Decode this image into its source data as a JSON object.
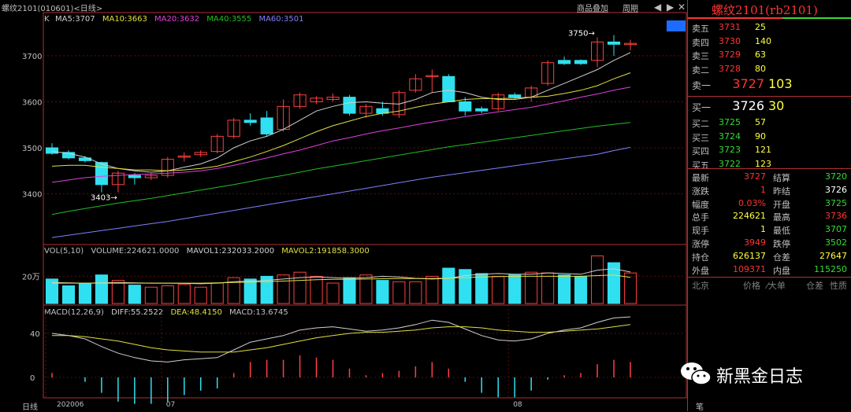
{
  "window": {
    "title": "螺纹2101(010601)<日线>",
    "product_overlay": "商品叠加",
    "period": "周期"
  },
  "ma_legend": {
    "k": "K",
    "ma5": "MA5:3707",
    "ma10": "MA10:3663",
    "ma20": "MA20:3632",
    "ma40": "MA40:3555",
    "ma60": "MA60:3501",
    "colors": {
      "ma5": "#d0d0d0",
      "ma10": "#e0e040",
      "ma20": "#e040e0",
      "ma40": "#20c020",
      "ma60": "#8080ff"
    }
  },
  "vol_legend": {
    "vol": "VOL(5,10)",
    "volume": "VOLUME:224621.0000",
    "mavol1": "MAVOL1:232033.2000",
    "mavol2": "MAVOL2:191858.3000"
  },
  "macd_legend": {
    "macd": "MACD(12,26,9)",
    "diff": "DIFF:55.2522",
    "dea": "DEA:48.4150",
    "macd_val": "MACD:13.6745"
  },
  "price_axis": [
    "3700",
    "3600",
    "3500",
    "3400"
  ],
  "vol_axis": [
    "20万"
  ],
  "macd_axis": [
    "40",
    "0"
  ],
  "date_axis": [
    "202006",
    "07",
    "08"
  ],
  "annotations": {
    "high": "3750",
    "low": "3403"
  },
  "bottom_tab": "日线",
  "chart_data": {
    "type": "candlestick",
    "candles": [
      {
        "o": 3500,
        "h": 3510,
        "l": 3485,
        "c": 3488
      },
      {
        "o": 3490,
        "h": 3495,
        "l": 3475,
        "c": 3478
      },
      {
        "o": 3478,
        "h": 3482,
        "l": 3468,
        "c": 3472
      },
      {
        "o": 3468,
        "h": 3470,
        "l": 3403,
        "c": 3420
      },
      {
        "o": 3420,
        "h": 3450,
        "l": 3403,
        "c": 3445
      },
      {
        "o": 3440,
        "h": 3445,
        "l": 3420,
        "c": 3435
      },
      {
        "o": 3435,
        "h": 3445,
        "l": 3430,
        "c": 3440
      },
      {
        "o": 3440,
        "h": 3480,
        "l": 3435,
        "c": 3475
      },
      {
        "o": 3480,
        "h": 3490,
        "l": 3470,
        "c": 3482
      },
      {
        "o": 3485,
        "h": 3495,
        "l": 3480,
        "c": 3490
      },
      {
        "o": 3492,
        "h": 3530,
        "l": 3488,
        "c": 3525
      },
      {
        "o": 3525,
        "h": 3565,
        "l": 3520,
        "c": 3560
      },
      {
        "o": 3560,
        "h": 3575,
        "l": 3548,
        "c": 3555
      },
      {
        "o": 3565,
        "h": 3580,
        "l": 3525,
        "c": 3530
      },
      {
        "o": 3540,
        "h": 3605,
        "l": 3535,
        "c": 3590
      },
      {
        "o": 3590,
        "h": 3620,
        "l": 3585,
        "c": 3615
      },
      {
        "o": 3600,
        "h": 3612,
        "l": 3595,
        "c": 3608
      },
      {
        "o": 3605,
        "h": 3618,
        "l": 3600,
        "c": 3610
      },
      {
        "o": 3610,
        "h": 3615,
        "l": 3570,
        "c": 3575
      },
      {
        "o": 3575,
        "h": 3595,
        "l": 3565,
        "c": 3590
      },
      {
        "o": 3585,
        "h": 3600,
        "l": 3570,
        "c": 3575
      },
      {
        "o": 3572,
        "h": 3625,
        "l": 3565,
        "c": 3620
      },
      {
        "o": 3625,
        "h": 3660,
        "l": 3620,
        "c": 3650
      },
      {
        "o": 3655,
        "h": 3670,
        "l": 3620,
        "c": 3657
      },
      {
        "o": 3655,
        "h": 3660,
        "l": 3600,
        "c": 3600
      },
      {
        "o": 3600,
        "h": 3610,
        "l": 3570,
        "c": 3580
      },
      {
        "o": 3585,
        "h": 3590,
        "l": 3575,
        "c": 3580
      },
      {
        "o": 3585,
        "h": 3620,
        "l": 3580,
        "c": 3615
      },
      {
        "o": 3615,
        "h": 3620,
        "l": 3605,
        "c": 3610
      },
      {
        "o": 3610,
        "h": 3635,
        "l": 3600,
        "c": 3630
      },
      {
        "o": 3640,
        "h": 3690,
        "l": 3635,
        "c": 3685
      },
      {
        "o": 3690,
        "h": 3698,
        "l": 3680,
        "c": 3683
      },
      {
        "o": 3690,
        "h": 3692,
        "l": 3680,
        "c": 3683
      },
      {
        "o": 3690,
        "h": 3740,
        "l": 3675,
        "c": 3730
      },
      {
        "o": 3730,
        "h": 3745,
        "l": 3700,
        "c": 3725
      },
      {
        "o": 3725,
        "h": 3735,
        "l": 3712,
        "c": 3727
      }
    ],
    "ma5": [
      3492,
      3488,
      3480,
      3465,
      3455,
      3450,
      3447,
      3450,
      3458,
      3465,
      3478,
      3500,
      3515,
      3525,
      3540,
      3560,
      3580,
      3590,
      3598,
      3600,
      3597,
      3595,
      3605,
      3620,
      3625,
      3620,
      3610,
      3605,
      3605,
      3610,
      3625,
      3640,
      3655,
      3670,
      3690,
      3707
    ],
    "ma10": [
      3460,
      3462,
      3462,
      3458,
      3455,
      3452,
      3452,
      3450,
      3452,
      3455,
      3460,
      3470,
      3480,
      3492,
      3505,
      3520,
      3535,
      3548,
      3558,
      3568,
      3575,
      3580,
      3588,
      3595,
      3600,
      3605,
      3607,
      3607,
      3608,
      3610,
      3612,
      3618,
      3625,
      3635,
      3650,
      3663
    ],
    "ma20": [
      3425,
      3430,
      3435,
      3438,
      3440,
      3442,
      3443,
      3445,
      3447,
      3450,
      3455,
      3462,
      3470,
      3478,
      3487,
      3495,
      3505,
      3515,
      3522,
      3530,
      3537,
      3543,
      3550,
      3556,
      3562,
      3568,
      3573,
      3578,
      3583,
      3588,
      3595,
      3602,
      3610,
      3617,
      3625,
      3632
    ],
    "ma40": [
      3355,
      3362,
      3368,
      3374,
      3380,
      3385,
      3390,
      3396,
      3402,
      3408,
      3414,
      3420,
      3427,
      3434,
      3440,
      3447,
      3454,
      3460,
      3466,
      3472,
      3478,
      3484,
      3490,
      3496,
      3502,
      3507,
      3512,
      3517,
      3522,
      3527,
      3532,
      3537,
      3542,
      3547,
      3551,
      3555
    ],
    "ma60": [
      3305,
      3310,
      3315,
      3320,
      3325,
      3330,
      3335,
      3340,
      3346,
      3352,
      3358,
      3364,
      3370,
      3376,
      3382,
      3388,
      3394,
      3400,
      3406,
      3412,
      3418,
      3424,
      3430,
      3436,
      3441,
      3446,
      3451,
      3456,
      3461,
      3466,
      3471,
      3476,
      3481,
      3486,
      3494,
      3501
    ],
    "volume": [
      180000,
      130000,
      145000,
      210000,
      170000,
      135000,
      120000,
      130000,
      140000,
      120000,
      150000,
      190000,
      180000,
      200000,
      210000,
      230000,
      200000,
      150000,
      190000,
      210000,
      170000,
      160000,
      160000,
      200000,
      260000,
      250000,
      220000,
      200000,
      210000,
      230000,
      225000,
      210000,
      200000,
      350000,
      300000,
      224621
    ],
    "mavol1": [
      155000,
      152000,
      150000,
      152000,
      155000,
      152000,
      150000,
      150000,
      148000,
      145000,
      150000,
      160000,
      165000,
      170000,
      180000,
      190000,
      195000,
      190000,
      185000,
      190000,
      200000,
      195000,
      185000,
      180000,
      185000,
      205000,
      215000,
      220000,
      215000,
      215000,
      225000,
      220000,
      215000,
      245000,
      255000,
      232033
    ],
    "mavol2": [
      150000,
      150000,
      150000,
      150000,
      150000,
      150000,
      150000,
      150000,
      150000,
      150000,
      152000,
      155000,
      158000,
      160000,
      165000,
      170000,
      175000,
      178000,
      178000,
      180000,
      182000,
      183000,
      183000,
      184000,
      186000,
      190000,
      195000,
      198000,
      200000,
      200000,
      200000,
      200000,
      200000,
      205000,
      210000,
      191858
    ],
    "diff": [
      40,
      38,
      35,
      28,
      22,
      18,
      15,
      14,
      16,
      17,
      18,
      25,
      32,
      35,
      38,
      43,
      45,
      46,
      44,
      42,
      43,
      45,
      48,
      52,
      50,
      44,
      38,
      34,
      33,
      35,
      40,
      43,
      45,
      50,
      54,
      55
    ],
    "dea": [
      38,
      38,
      37,
      35,
      33,
      30,
      27,
      25,
      24,
      23,
      23,
      23,
      25,
      27,
      30,
      33,
      36,
      38,
      40,
      41,
      41,
      42,
      43,
      45,
      46,
      46,
      45,
      43,
      42,
      41,
      41,
      42,
      43,
      44,
      46,
      48
    ],
    "ylim": [
      3300,
      3770
    ]
  },
  "quote": {
    "title": "螺纹2101(rb2101)",
    "asks": [
      {
        "label": "卖五",
        "price": "3731",
        "vol": "25"
      },
      {
        "label": "卖四",
        "price": "3730",
        "vol": "140"
      },
      {
        "label": "卖三",
        "price": "3729",
        "vol": "63"
      },
      {
        "label": "卖二",
        "price": "3728",
        "vol": "80"
      },
      {
        "label": "卖一",
        "price": "3727",
        "vol": "103"
      }
    ],
    "bids": [
      {
        "label": "买一",
        "price": "3726",
        "vol": "30"
      },
      {
        "label": "买二",
        "price": "3725",
        "vol": "57"
      },
      {
        "label": "买三",
        "price": "3724",
        "vol": "90"
      },
      {
        "label": "买四",
        "price": "3723",
        "vol": "121"
      },
      {
        "label": "买五",
        "price": "3722",
        "vol": "123"
      }
    ],
    "stats": [
      {
        "l1": "最新",
        "v1": "3727",
        "c1": "red",
        "l2": "结算",
        "v2": "3720",
        "c2": "green"
      },
      {
        "l1": "涨跌",
        "v1": "1",
        "c1": "red",
        "l2": "昨结",
        "v2": "3726",
        "c2": "white"
      },
      {
        "l1": "幅度",
        "v1": "0.03%",
        "c1": "red",
        "l2": "开盘",
        "v2": "3725",
        "c2": "green"
      },
      {
        "l1": "总手",
        "v1": "224621",
        "c1": "yellow",
        "l2": "最高",
        "v2": "3736",
        "c2": "red"
      },
      {
        "l1": "现手",
        "v1": "1",
        "c1": "yellow",
        "l2": "最低",
        "v2": "3707",
        "c2": "green"
      },
      {
        "l1": "涨停",
        "v1": "3949",
        "c1": "red",
        "l2": "跌停",
        "v2": "3502",
        "c2": "green"
      },
      {
        "l1": "持仓",
        "v1": "626137",
        "c1": "yellow",
        "l2": "仓差",
        "v2": "27647",
        "c2": "yellow"
      },
      {
        "l1": "外盘",
        "v1": "109371",
        "c1": "red",
        "l2": "内盘",
        "v2": "115250",
        "c2": "green"
      }
    ],
    "footer": {
      "city": "北京",
      "price": "价格",
      "big": "⁄大单",
      "pos": "仓差",
      "nature": "性质"
    },
    "bottom_tab": "笔"
  },
  "watermark": {
    "text": "新黑金日志"
  }
}
